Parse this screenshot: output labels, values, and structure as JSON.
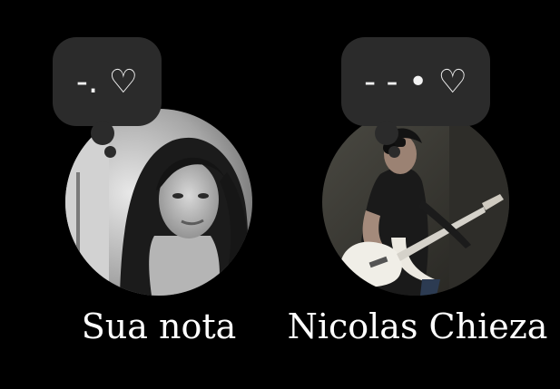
{
  "notes": [
    {
      "bubble_text": "-. ♡",
      "name": "Sua nota"
    },
    {
      "bubble_text": "- - • ♡",
      "name": "Nicolas Chieza"
    }
  ],
  "colors": {
    "background": "#000000",
    "bubble": "#2b2b2b",
    "text": "#ffffff"
  }
}
